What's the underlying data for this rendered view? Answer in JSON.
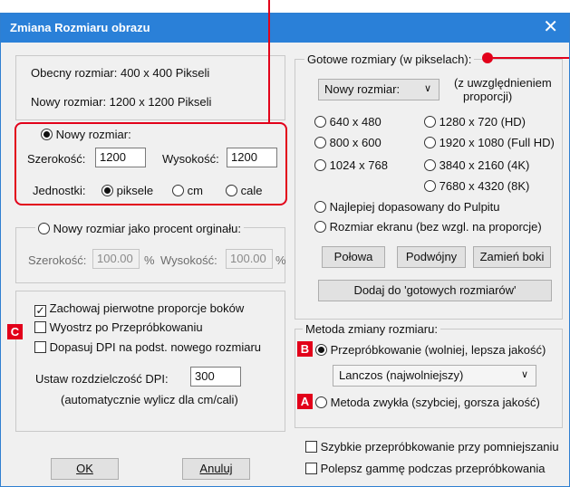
{
  "dialog": {
    "title": "Zmiana Rozmiaru obrazu",
    "close_glyph": "✕"
  },
  "info": {
    "current_size": "Obecny rozmiar:  400  x  400  Pikseli",
    "new_size": "Nowy rozmiar:   1200  x  1200  Pikseli"
  },
  "new_size_group": {
    "radio_label": "Nowy rozmiar:",
    "width_label": "Szerokość:",
    "width_value": "1200",
    "height_label": "Wysokość:",
    "height_value": "1200",
    "units_label": "Jednostki:",
    "unit_pixels": "piksele",
    "unit_cm": "cm",
    "unit_inch": "cale"
  },
  "percent_group": {
    "radio_label": "Nowy rozmiar jako procent orginału:",
    "width_label": "Szerokość:",
    "width_value": "100.00",
    "height_label": "Wysokość:",
    "height_value": "100.00",
    "percent_sign": "%"
  },
  "options": {
    "keep_proportions": "Zachowaj pierwotne proporcje boków",
    "sharpen": "Wyostrz po Przepróbkowaniu",
    "adjust_dpi": "Dopasuj DPI na podst. nowego rozmiaru",
    "dpi_label": "Ustaw rozdzielczość DPI:",
    "dpi_value": "300",
    "dpi_note": "(automatycznie wylicz dla cm/cali)"
  },
  "presets": {
    "legend": "Gotowe rozmiary (w pikselach):",
    "dropdown_value": "Nowy rozmiar:",
    "dropdown_note_1": "(z uwzględnieniem",
    "dropdown_note_2": "proporcji)",
    "size_640": "640 x 480",
    "size_800": "800 x 600",
    "size_1024": "1024 x 768",
    "size_1280": "1280 x 720   (HD)",
    "size_1920": "1920 x 1080 (Full HD)",
    "size_3840": "3840 x 2160 (4K)",
    "size_7680": "7680 x 4320 (8K)",
    "best_fit": "Najlepiej dopasowany do Pulpitu",
    "screen_size": "Rozmiar ekranu  (bez wzgl. na proporcje)",
    "half_button": "Połowa",
    "double_button": "Podwójny",
    "swap_button": "Zamień boki",
    "add_button": "Dodaj do 'gotowych rozmiarów'"
  },
  "method": {
    "legend": "Metoda zmiany rozmiaru:",
    "resample": "Przepróbkowanie (wolniej, lepsza jakość)",
    "filter_value": "Lanczos  (najwolniejszy)",
    "simple": "Metoda zwykła (szybciej, gorsza jakość)"
  },
  "extra": {
    "fast_downscale": "Szybkie przepróbkowanie przy pomniejszaniu",
    "gamma": "Polepsz gammę podczas przepróbkowania"
  },
  "buttons": {
    "ok": "OK",
    "cancel": "Anuluj"
  },
  "badges": {
    "a": "A",
    "b": "B",
    "c": "C"
  },
  "colors": {
    "titlebar": "#2a80d8",
    "annotation_red": "#e2001a"
  }
}
